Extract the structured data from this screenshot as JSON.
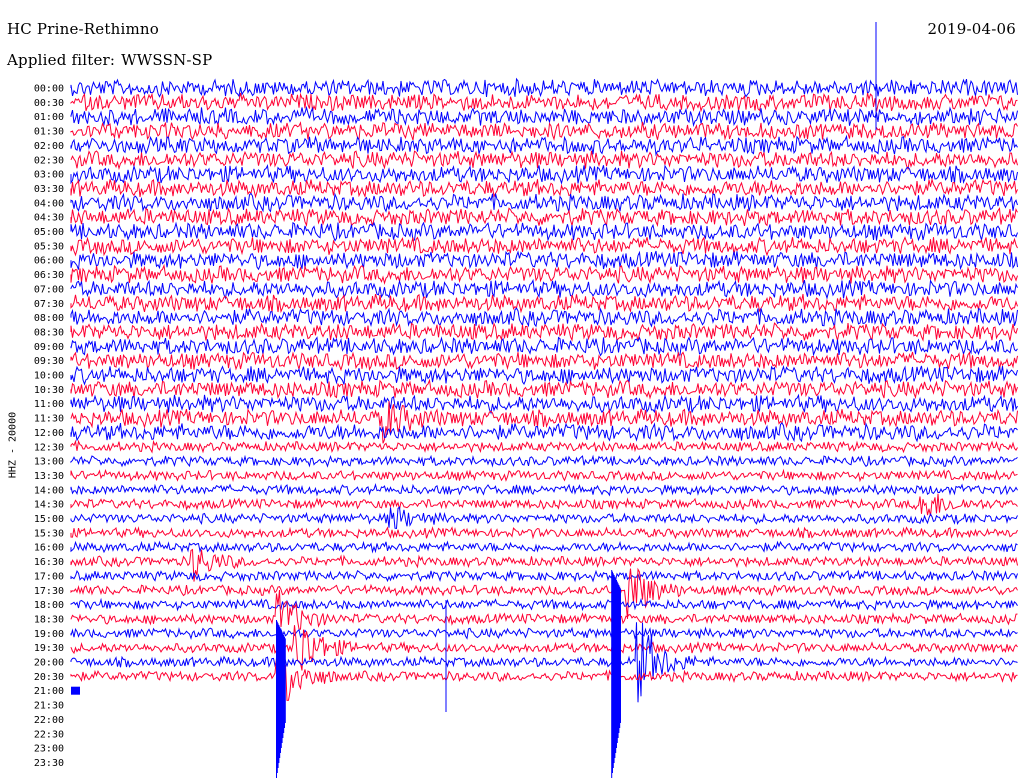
{
  "header": {
    "station": "HC Prine-Rethimno",
    "date": "2019-04-06",
    "filter_label": "Applied filter:",
    "filter_name": "WWSSN-SP"
  },
  "chart_data": {
    "type": "line",
    "title": "HC Prine-Rethimno",
    "subtitle": "Applied filter: WWSSN-SP",
    "ylabel": "HHZ - 20000",
    "xlabel": "",
    "ylim": [
      0,
      24
    ],
    "grid": false,
    "y_ticks": [
      "00:00",
      "00:30",
      "01:00",
      "01:30",
      "02:00",
      "02:30",
      "03:00",
      "03:30",
      "04:00",
      "04:30",
      "05:00",
      "05:30",
      "06:00",
      "06:30",
      "07:00",
      "07:30",
      "08:00",
      "08:30",
      "09:00",
      "09:30",
      "10:00",
      "10:30",
      "11:00",
      "11:30",
      "12:00",
      "12:30",
      "13:00",
      "13:30",
      "14:00",
      "14:30",
      "15:00",
      "15:30",
      "16:00",
      "16:30",
      "17:00",
      "17:30",
      "18:00",
      "18:30",
      "19:00",
      "19:30",
      "20:00",
      "20:30",
      "21:00",
      "21:30",
      "22:00",
      "22:30",
      "23:00",
      "23:30"
    ],
    "series": [
      {
        "color": "#0000ff",
        "rows": "even"
      },
      {
        "color": "#ff0033",
        "rows": "odd"
      }
    ],
    "record_end": "21:00",
    "events": [
      {
        "row": "17:30",
        "x": 0.59,
        "scale": 6
      },
      {
        "row": "18:30",
        "x": 0.22,
        "scale": 5
      },
      {
        "row": "19:30",
        "x": 0.24,
        "scale": 6
      },
      {
        "row": "20:00",
        "x": 0.6,
        "scale": 8
      },
      {
        "row": "20:30",
        "x": 0.22,
        "scale": 7
      },
      {
        "row": "16:30",
        "x": 0.13,
        "scale": 3
      },
      {
        "row": "15:00",
        "x": 0.34,
        "scale": 2
      },
      {
        "row": "14:30",
        "x": 0.9,
        "scale": 3
      },
      {
        "row": "11:30",
        "x": 0.33,
        "scale": 2
      }
    ]
  }
}
